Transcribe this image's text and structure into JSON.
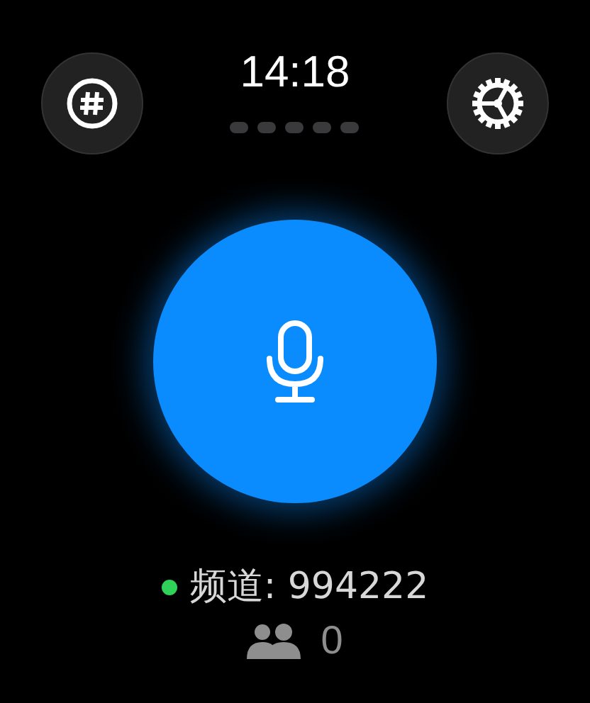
{
  "time": "14:18",
  "channel": {
    "label": "频道: 994222",
    "color": "#30d158"
  },
  "members": {
    "count": "0"
  }
}
